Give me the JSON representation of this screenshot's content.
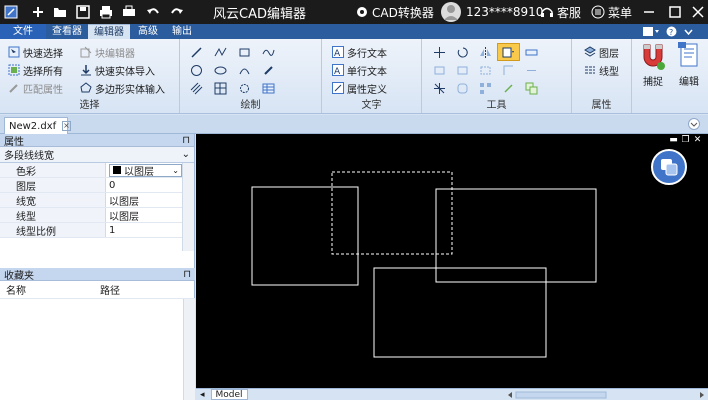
{
  "titlebar": {
    "app_title": "风云CAD编辑器",
    "converter_label": "CAD转换器",
    "user_id": "123****8910",
    "service_label": "客服",
    "menu_label": "菜单"
  },
  "tabs": [
    {
      "label": "文件"
    },
    {
      "label": "查看器"
    },
    {
      "label": "编辑器"
    },
    {
      "label": "高级"
    },
    {
      "label": "输出"
    }
  ],
  "ribbon": {
    "select_group": {
      "label": "选择",
      "items": [
        "快速选择",
        "选择所有",
        "匹配属性",
        "块编辑器",
        "快速实体导入",
        "多边形实体输入"
      ]
    },
    "draw_group": {
      "label": "绘制"
    },
    "text_group": {
      "label": "文字",
      "items": [
        "多行文本",
        "单行文本",
        "属性定义"
      ]
    },
    "tools_group": {
      "label": "工具"
    },
    "props_group": {
      "label": "属性",
      "items": [
        "图层",
        "线型"
      ]
    },
    "snap_label": "捕捉",
    "edit_label": "编辑"
  },
  "document": {
    "tab_label": "New2.dxf",
    "model_tab": "Model"
  },
  "properties_panel": {
    "title": "属性",
    "object_type": "多段线线宽",
    "rows": [
      {
        "key": "色彩",
        "value": "以图层"
      },
      {
        "key": "图层",
        "value": "0"
      },
      {
        "key": "线宽",
        "value": "以图层"
      },
      {
        "key": "线型",
        "value": "以图层"
      },
      {
        "key": "线型比例",
        "value": "1"
      }
    ]
  },
  "favorites_panel": {
    "title": "收藏夹",
    "columns": [
      "名称",
      "路径"
    ]
  },
  "colors": {
    "title_bg": "#1b1b1b",
    "tab_bg": "#2b5c9e",
    "ribbon_bg": "#d7e4f4",
    "canvas_bg": "#000000",
    "accent": "#3f74c8"
  }
}
